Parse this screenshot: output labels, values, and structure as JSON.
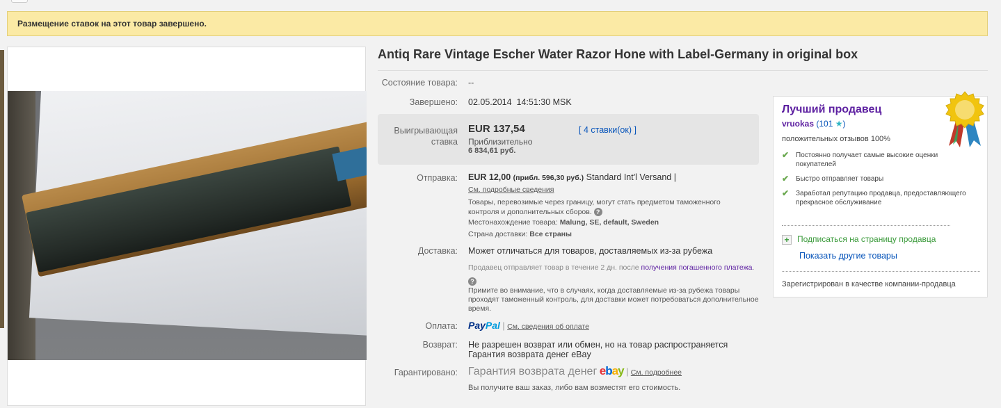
{
  "banner": {
    "text": "Размещение ставок на этот товар завершено."
  },
  "title": "Antiq Rare Vintage Escher Water Razor Hone with Label-Germany in original box",
  "condition": {
    "label": "Состояние товара:",
    "value": "--"
  },
  "ended": {
    "label": "Завершено:",
    "value": "02.05.2014  14:51:30 MSK"
  },
  "bid": {
    "label": "Выигрывающая ставка",
    "amount": "EUR 137,54",
    "approx_label": "Приблизительно",
    "approx_value": "6 834,61 руб.",
    "bids_link": "4 ставки(ок)",
    "bracket_open": "[",
    "bracket_close": "]"
  },
  "shipping": {
    "label": "Отправка:",
    "price": "EUR 12,00",
    "approx": "(прибл. 596,30 руб.)",
    "method": "Standard Int'l Versand |",
    "details_link": "См. подробные сведения",
    "customs_note": "Товары, перевозимые через границу, могут стать предметом таможенного контроля и дополнительных сборов.",
    "location_label": "Местонахождение товара:",
    "location_value": "Malung, SE, default, Sweden",
    "ships_to_label": "Страна доставки:",
    "ships_to_value": "Все страны"
  },
  "delivery": {
    "label": "Доставка:",
    "main": "Может отличаться для товаров, доставляемых из-за рубежа",
    "dispatch_text": "Продавец отправляет товар в течение 2 дн. после",
    "dispatch_link_1": "получения погашенного",
    "dispatch_link_2": "платежа",
    "dispatch_dot": ".",
    "note": "Примите во внимание, что в случаях, когда доставляемые из-за рубежа товары проходят таможенный контроль, для доставки может потребоваться дополнительное время."
  },
  "payment": {
    "label": "Оплата:",
    "paypal_pay": "Pay",
    "paypal_pal": "Pal",
    "sep": "|",
    "link": "См. сведения об оплате"
  },
  "returns": {
    "label": "Возврат:",
    "text": "Не разрешен возврат или обмен, но на товар распространяется",
    "link": "Гарантия возврата денег eBay"
  },
  "guarantee": {
    "label": "Гарантировано:",
    "text": "Гарантия возврата денег",
    "ebay": [
      "e",
      "b",
      "a",
      "y"
    ],
    "sep": "|",
    "link": "См. подробнее",
    "note": "Вы получите ваш заказ, либо вам возместят его стоимость."
  },
  "seller": {
    "header": "Лучший продавец",
    "name": "vruokas",
    "score_open": "(101",
    "score_close": ")",
    "star": "★",
    "feedback": "положительных отзывов 100%",
    "points": [
      "Постоянно получает самые высокие оценки покупателей",
      "Быстро отправляет товары",
      "Заработал репутацию продавца, предоставляющего прекрасное обслуживание"
    ],
    "subscribe": "Подписаться на страницу продавца",
    "other_items": "Показать другие товары",
    "registered": "Зарегистрирован в качестве компании-продавца"
  },
  "colors": {
    "banner_bg": "#fbeaa5",
    "link": "#0654ba",
    "seller_purple": "#5d20a1",
    "check_green": "#6aa84f"
  }
}
